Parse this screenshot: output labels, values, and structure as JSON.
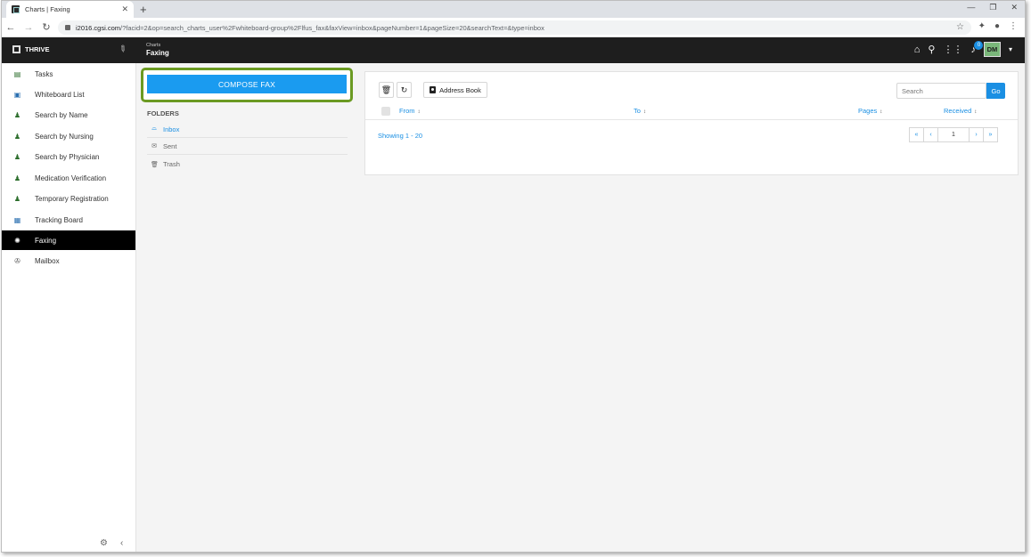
{
  "browser": {
    "tab_title": "Charts | Faxing",
    "new_tab": "+",
    "url_host": "i2016.cgsi.com",
    "url_rest": "/?facid=2&op=search_charts_user%2Fwhiteboard-group%2Flfus_fax&faxView=inbox&pageNumber=1&pageSize=20&searchText=&type=inbox"
  },
  "header": {
    "brand": "THRIVE",
    "crumb_parent": "Charts",
    "crumb_title": "Faxing",
    "notification_count": "0",
    "avatar_initials": "DM"
  },
  "sidebar": {
    "items": [
      {
        "label": "Tasks",
        "icon": "tasks-icon"
      },
      {
        "label": "Whiteboard List",
        "icon": "whiteboard-icon"
      },
      {
        "label": "Search by Name",
        "icon": "person-icon"
      },
      {
        "label": "Search by Nursing",
        "icon": "person-icon"
      },
      {
        "label": "Search by Physician",
        "icon": "person-icon"
      },
      {
        "label": "Medication Verification",
        "icon": "person-icon"
      },
      {
        "label": "Temporary Registration",
        "icon": "person-icon"
      },
      {
        "label": "Tracking Board",
        "icon": "board-icon"
      },
      {
        "label": "Faxing",
        "icon": "fax-icon",
        "active": true
      },
      {
        "label": "Mailbox",
        "icon": "mailbox-icon"
      }
    ]
  },
  "compose": {
    "label": "COMPOSE FAX"
  },
  "folders": {
    "title": "FOLDERS",
    "items": [
      {
        "label": "Inbox",
        "active": true
      },
      {
        "label": "Sent"
      },
      {
        "label": "Trash"
      }
    ]
  },
  "toolbar": {
    "address_book": "Address Book",
    "search_placeholder": "Search",
    "go": "Go"
  },
  "table": {
    "columns": [
      "From",
      "To",
      "Pages",
      "Received"
    ]
  },
  "pagination": {
    "showing": "Showing 1 - 20",
    "page": "1"
  },
  "colors": {
    "accent": "#1a8fe3",
    "compose_button": "#1a9bf0",
    "highlight_border": "#6b9a22",
    "header_bg": "#1e1e1e"
  }
}
